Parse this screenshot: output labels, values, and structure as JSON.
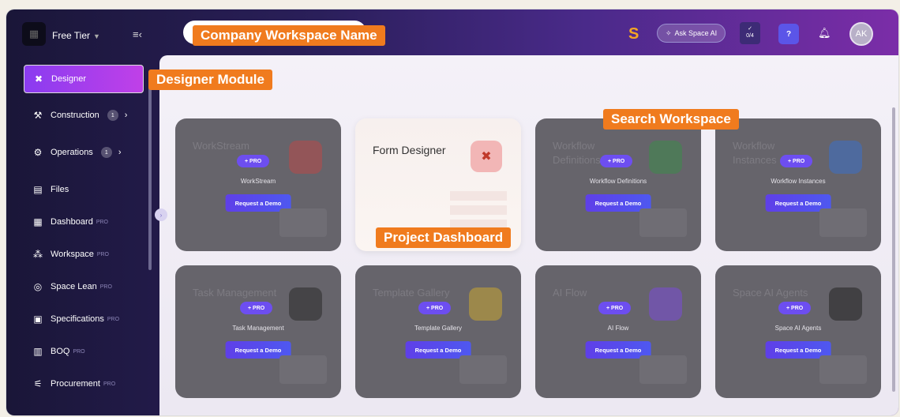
{
  "header": {
    "tier_label": "Free Tier",
    "ask_label": "Ask Space AI",
    "progress": "0/4",
    "help_label": "?",
    "avatar_initials": "AK"
  },
  "callouts": {
    "workspace_name": "Company Workspace Name",
    "designer_module": "Designer Module",
    "search_workspace": "Search Workspace",
    "project_dashboard": "Project Dashboard"
  },
  "sidebar": {
    "items": [
      {
        "label": "Designer",
        "icon": "designer-icon",
        "active": true
      },
      {
        "label": "Construction",
        "icon": "tools-icon",
        "badge": "1"
      },
      {
        "label": "Operations",
        "icon": "gear-icon",
        "badge": "1"
      },
      {
        "label": "Files",
        "icon": "file-icon"
      },
      {
        "label": "Dashboard",
        "icon": "dashboard-icon",
        "pro": "PRO"
      },
      {
        "label": "Workspace",
        "icon": "workspace-icon",
        "pro": "PRO"
      },
      {
        "label": "Space Lean",
        "icon": "lean-icon",
        "pro": "PRO"
      },
      {
        "label": "Specifications",
        "icon": "specifications-icon",
        "pro": "PRO"
      },
      {
        "label": "BOQ",
        "icon": "boq-icon",
        "pro": "PRO"
      },
      {
        "label": "Procurement",
        "icon": "procurement-icon",
        "pro": "PRO"
      }
    ]
  },
  "cards": {
    "pro_chip": "+ PRO",
    "demo_label": "Request a Demo",
    "form_designer": "Form Designer",
    "items": [
      {
        "ghost": "WorkStream",
        "name": "WorkStream",
        "color": "#b84848"
      },
      {
        "ghost": "Workflow Definitions",
        "name": "Workflow Definitions",
        "color": "#3d8a4a"
      },
      {
        "ghost": "Workflow Instances",
        "name": "Workflow Instances",
        "color": "#3a70c8"
      },
      {
        "ghost": "Task Management",
        "name": "Task Management",
        "color": "#2a2a2a"
      },
      {
        "ghost": "Template Gallery",
        "name": "Template Gallery",
        "color": "#c8a632"
      },
      {
        "ghost": "AI Flow",
        "name": "AI Flow",
        "color": "#7a4ad8"
      },
      {
        "ghost": "Space AI Agents",
        "name": "Space AI Agents",
        "color": "#222222"
      }
    ]
  }
}
